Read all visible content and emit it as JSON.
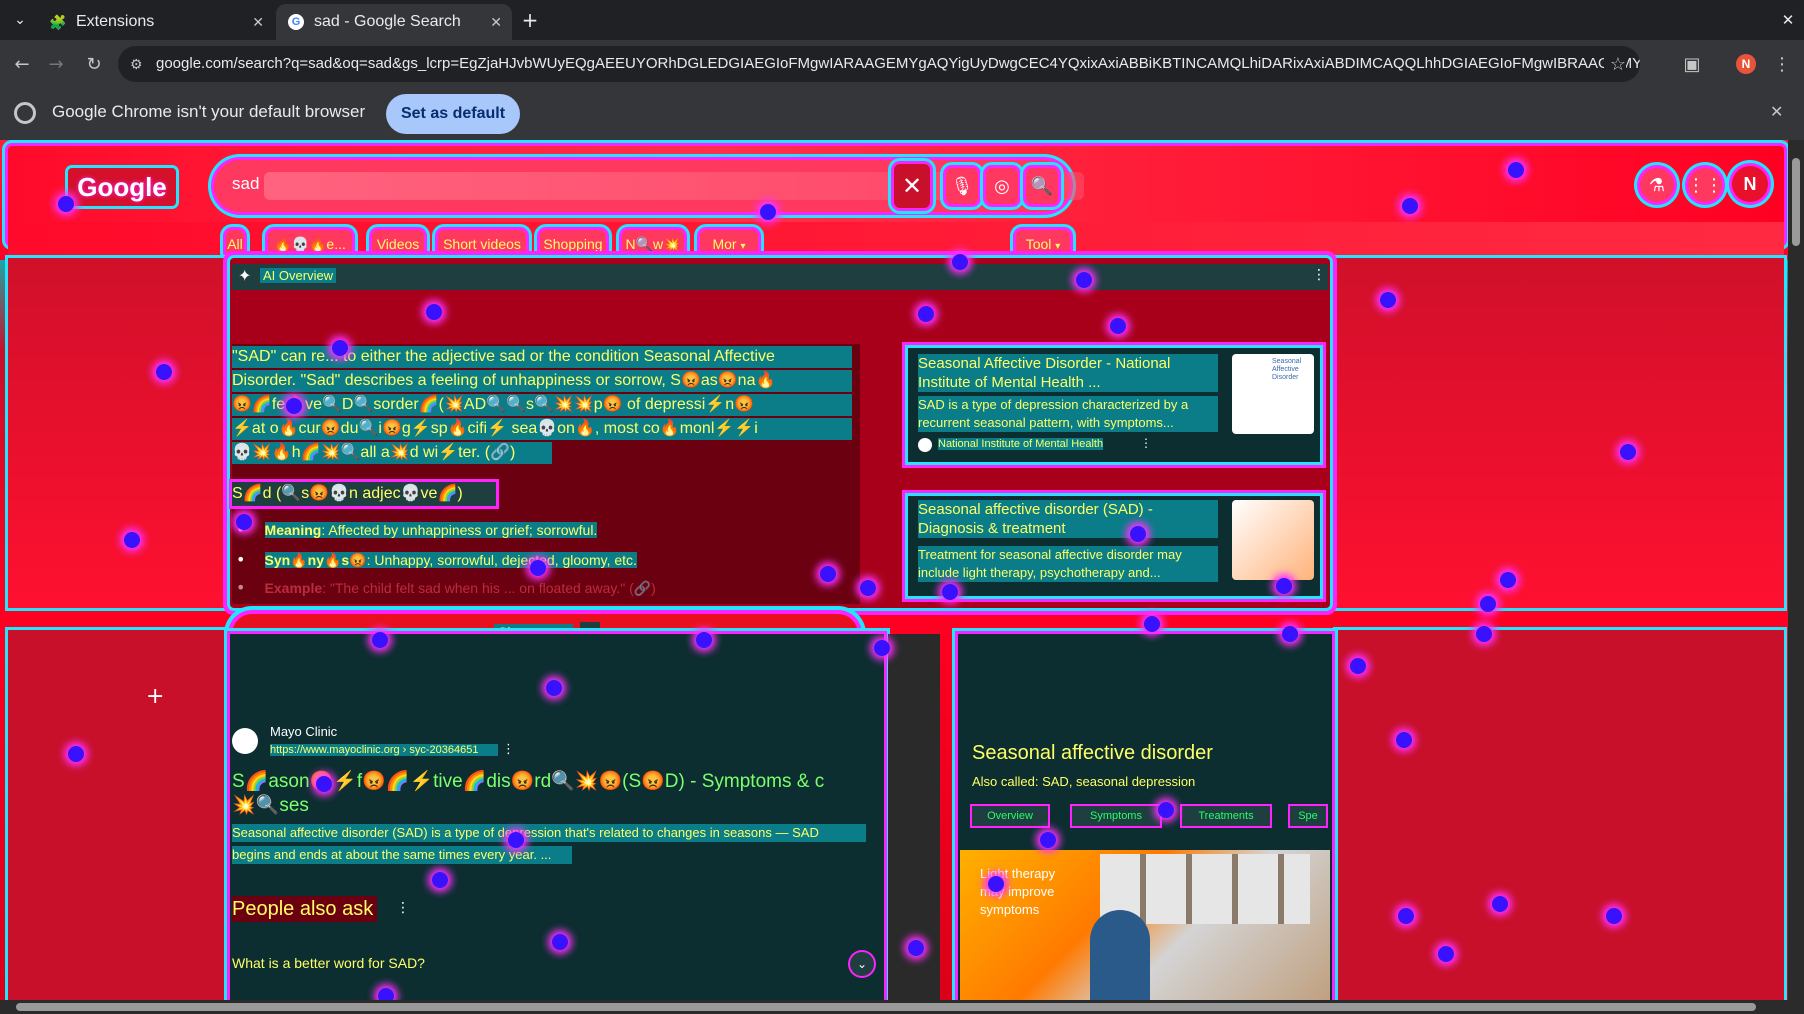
{
  "tabs": [
    {
      "label": "Extensions",
      "icon": "puzzle-icon",
      "active": false
    },
    {
      "label": "sad - Google Search",
      "icon": "google-g-icon",
      "active": true
    }
  ],
  "omnibox": {
    "url": "google.com/search?q=sad&oq=sad&gs_lcrp=EgZjaHJvbWUyEQgAEEUYORhDGLEDGIAEGIoFMgwIARAAGEMYgAQYigUyDwgCEC4YQxixAxiABBiKBTINCAMQLhiDARixAxiABDIMCAQQLhhDGIAEGIoFMgwIBRAAGEMYgAQY..."
  },
  "profile_initial": "N",
  "infobar": {
    "message": "Google Chrome isn't your default browser",
    "button": "Set as default"
  },
  "search": {
    "logo": "Google",
    "query": "sad",
    "filters": [
      "All",
      "🔥💀🔥e...",
      "Videos",
      "Short videos",
      "Shopping",
      "N🔍w💥",
      "Mor"
    ],
    "tools": "Tool"
  },
  "ai_overview": {
    "label": "AI Overview",
    "lines": [
      "\"SAD\" can re... to either the adjective sad or the condition Seasonal Affective",
      "Disorder. \"Sad\" describes a feeling of unhappiness or sorrow, S😡as😡na🔥",
      "😡🌈fe🔥ve🔍D🔍sorder🌈(💥AD🔍🔍s🔍💥💥p😡 of depressi⚡n😡",
      "⚡at o🔥cur😡du🔍i😡g⚡sp🔥cifi⚡ sea💀on🔥, most co🔥monl⚡⚡i",
      "💀💥🔥h🌈💥🔍all a💥d wi⚡ter. (🔗)"
    ],
    "subheading": "S🌈d (🔍s😡💀n adjec💀ve🌈)",
    "bullets": [
      {
        "label": "Meaning",
        "text": ": Affected by unhappiness or grief; sorrowful."
      },
      {
        "label": "Syn🔥ny🔥s😡",
        "text": ": Unhappy, sorrowful, dejected, gloomy, etc."
      },
      {
        "label": "Example",
        "text": ": \"The child felt sad when his ... on floated away.\" (🔗)"
      }
    ],
    "show_more": "Show more"
  },
  "source_cards": [
    {
      "title": "Seasonal Affective Disorder - National Institute of Mental Health ...",
      "snippet": "SAD is a type of depression characterized by a recurrent seasonal pattern, with symptoms...",
      "source": "National Institute of Mental Health",
      "thumb_label": "Seasonal Affective Disorder"
    },
    {
      "title": "Seasonal affective disorder (SAD) - Diagnosis & treatment",
      "snippet": "Treatment for seasonal affective disorder may include light therapy, psychotherapy and...",
      "source": ""
    }
  ],
  "result": {
    "site": "Mayo Clinic",
    "url": "https://www.mayoclinic.org › syc-20364651",
    "title": "S🌈ason😡⚡f😡🌈⚡tive🌈dis😡rd🔍💥😡(S😡D) - Symptoms & c",
    "title2": "💥🔍ses",
    "snippet1": "Seasonal affective disorder (SAD) is a type of depression that's related to changes in seasons — SAD",
    "snippet2": "begins and ends at about the same times every year. ..."
  },
  "paa": {
    "heading": "People also ask",
    "question": "What is a better word for SAD?"
  },
  "knowledge_panel": {
    "title": "Seasonal affective disorder",
    "also_called": "Also called: SAD, seasonal depression",
    "tabs": [
      "Overview",
      "Symptoms",
      "Treatments",
      "Spe"
    ],
    "image_caption": [
      "Light therapy",
      "may improve",
      "symptoms"
    ]
  },
  "colors": {
    "chrome_bg": "#202124",
    "toolbar": "#35363a",
    "accent": "#a8c7fa",
    "neon_magenta": "#ff22ff",
    "neon_cyan": "#22e6ff",
    "red": "#ff0026",
    "text_yellow": "#ffff66"
  }
}
